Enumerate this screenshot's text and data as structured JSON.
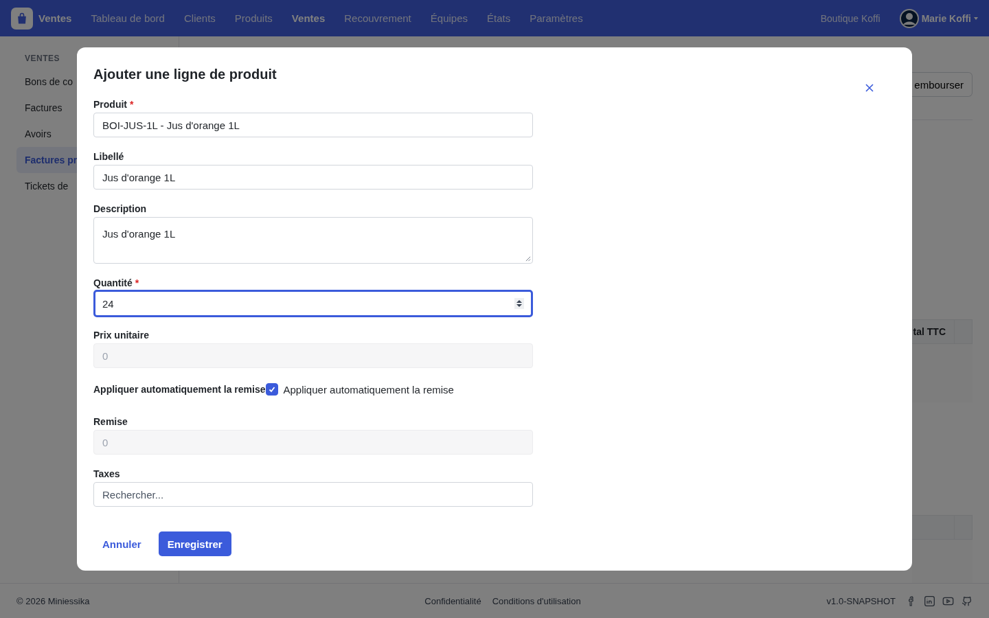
{
  "top_nav": {
    "brand": "Ventes",
    "items": [
      {
        "label": "Tableau de bord",
        "selected": false
      },
      {
        "label": "Clients",
        "selected": false
      },
      {
        "label": "Produits",
        "selected": false
      },
      {
        "label": "Ventes",
        "selected": true
      },
      {
        "label": "Recouvrement",
        "selected": false
      },
      {
        "label": "Équipes",
        "selected": false
      },
      {
        "label": "États",
        "selected": false
      },
      {
        "label": "Paramètres",
        "selected": false
      }
    ],
    "shop": "Boutique Koffi",
    "user": "Marie Koffi"
  },
  "sidebar": {
    "heading": "VENTES",
    "items": [
      {
        "label": "Bons de co",
        "selected": false
      },
      {
        "label": "Factures",
        "selected": false
      },
      {
        "label": "Avoirs",
        "selected": false
      },
      {
        "label": "Factures pr",
        "selected": true
      },
      {
        "label": "Tickets de",
        "selected": false
      }
    ]
  },
  "page": {
    "action_button": "embourser",
    "table_header": "tal TTC"
  },
  "modal": {
    "title": "Ajouter une ligne de produit",
    "fields": [
      {
        "kind": "text",
        "label": "Produit",
        "required_mark": "*",
        "value": "BOI-JUS-1L - Jus d'orange 1L",
        "disabled": false,
        "focused": false
      },
      {
        "kind": "text",
        "label": "Libellé",
        "value": "Jus d'orange 1L",
        "disabled": false,
        "focused": false
      },
      {
        "kind": "textarea",
        "label": "Description",
        "value": "Jus d'orange 1L",
        "disabled": false,
        "focused": false
      },
      {
        "kind": "number",
        "label": "Quantité",
        "required_mark": "*",
        "value": "24",
        "disabled": false,
        "focused": true
      },
      {
        "kind": "text",
        "label": "Prix unitaire",
        "placeholder": "0",
        "disabled": true,
        "focused": false
      },
      {
        "kind": "checkbox",
        "label": "Appliquer automatiquement la remise",
        "checked": true,
        "caption": "Appliquer automatiquement la remise"
      },
      {
        "kind": "text",
        "label": "Remise",
        "placeholder": "0",
        "disabled": true,
        "focused": false
      },
      {
        "kind": "text",
        "label": "Taxes",
        "placeholder": "Rechercher...",
        "disabled": false,
        "focused": false
      }
    ],
    "cancel": "Annuler",
    "save": "Enregistrer"
  },
  "footer": {
    "copyright": "© 2026 Miniessika",
    "links": [
      "Confidentialité",
      "Conditions d'utilisation"
    ],
    "version": "v1.0-SNAPSHOT"
  }
}
